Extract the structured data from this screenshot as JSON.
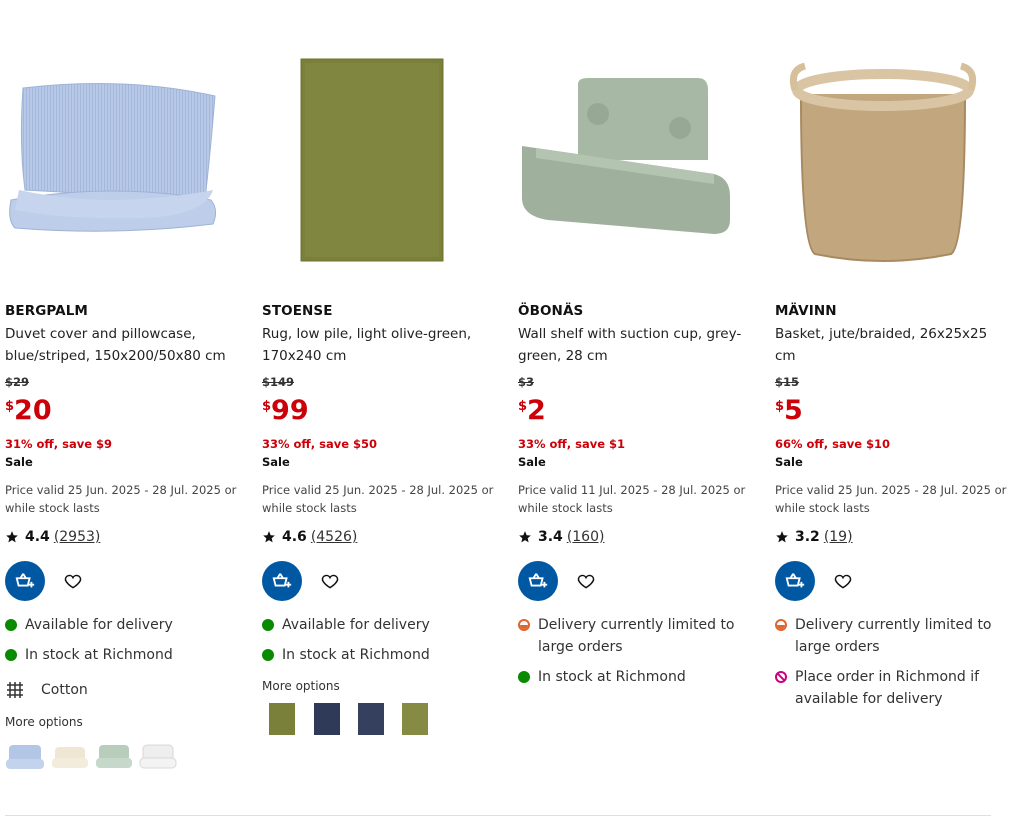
{
  "products": [
    {
      "name": "BERGPALM",
      "description": "Duvet cover and pillowcase, blue/striped, 150x200/50x80 cm",
      "old_price": "$29",
      "currency": "$",
      "price": "20",
      "savings": "31% off, save $9",
      "sale_label": "Sale",
      "validity": "Price valid 25 Jun. 2025 - 28 Jul. 2025 or while stock lasts",
      "rating": "4.4",
      "review_count": "(2953)",
      "availability": [
        {
          "status": "green",
          "text": "Available for delivery"
        },
        {
          "status": "green",
          "text": "In stock at Richmond"
        }
      ],
      "material": "Cotton",
      "material_icon": "fabric-pattern-icon",
      "more_options_label": "More options",
      "variants": [
        "blue/striped",
        "beige",
        "grey-green",
        "white"
      ]
    },
    {
      "name": "STOENSE",
      "description": "Rug, low pile, light olive-green, 170x240 cm",
      "old_price": "$149",
      "currency": "$",
      "price": "99",
      "savings": "33% off, save $50",
      "sale_label": "Sale",
      "validity": "Price valid 25 Jun. 2025 - 28 Jul. 2025 or while stock lasts",
      "rating": "4.6",
      "review_count": "(4526)",
      "availability": [
        {
          "status": "green",
          "text": "Available for delivery"
        },
        {
          "status": "green",
          "text": "In stock at Richmond"
        }
      ],
      "more_options_label": "More options",
      "variants": [
        "light olive-green",
        "dark blue",
        "dark blue",
        "olive-green"
      ]
    },
    {
      "name": "ÖBONÄS",
      "description": "Wall shelf with suction cup, grey-green, 28 cm",
      "old_price": "$3",
      "currency": "$",
      "price": "2",
      "savings": "33% off, save $1",
      "sale_label": "Sale",
      "validity": "Price valid 11 Jul. 2025 - 28 Jul. 2025 or while stock lasts",
      "rating": "3.4",
      "review_count": "(160)",
      "availability": [
        {
          "status": "orange",
          "text": "Delivery currently limited to large orders"
        },
        {
          "status": "green",
          "text": "In stock at Richmond"
        }
      ]
    },
    {
      "name": "MÄVINN",
      "description": "Basket, jute/braided, 26x25x25 cm",
      "old_price": "$15",
      "currency": "$",
      "price": "5",
      "savings": "66% off, save $10",
      "sale_label": "Sale",
      "validity": "Price valid 25 Jun. 2025 - 28 Jul. 2025 or while stock lasts",
      "rating": "3.2",
      "review_count": "(19)",
      "availability": [
        {
          "status": "orange",
          "text": "Delivery currently limited to large orders"
        },
        {
          "status": "noentry",
          "text": "Place order in Richmond if available for delivery"
        }
      ]
    }
  ],
  "icons": {
    "cart": "add-to-cart-icon",
    "favourite": "heart-icon",
    "rating": "star-icon"
  },
  "colors": {
    "accent_blue": "#0058a3",
    "price_red": "#cc0008",
    "status_green": "#0a8a00",
    "status_orange": "#e0662e",
    "status_magenta": "#cc0080"
  }
}
